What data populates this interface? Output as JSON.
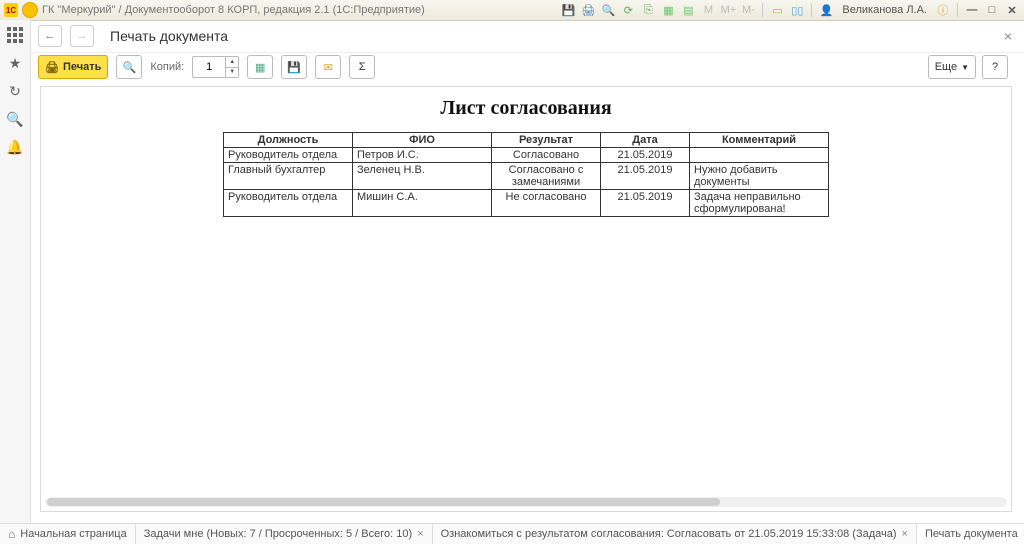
{
  "titlebar": {
    "logo_text": "1C",
    "app_title": "ГК \"Меркурий\" / Документооборот 8 КОРП, редакция 2.1  (1С:Предприятие)",
    "username": "Великанова Л.А."
  },
  "header": {
    "page_title": "Печать документа"
  },
  "toolbar": {
    "print_label": "Печать",
    "copies_label": "Копий:",
    "copies_value": "1",
    "more_label": "Еще",
    "help_label": "?"
  },
  "document": {
    "title": "Лист согласования",
    "columns": {
      "position": "Должность",
      "fio": "ФИО",
      "result": "Результат",
      "date": "Дата",
      "comment": "Комментарий"
    },
    "rows": [
      {
        "position": "Руководитель отдела",
        "fio": "Петров И.С.",
        "result": "Согласовано",
        "date": "21.05.2019",
        "comment": ""
      },
      {
        "position": "Главный бухгалтер",
        "fio": "Зеленец Н.В.",
        "result": "Согласовано с замечаниями",
        "date": "21.05.2019",
        "comment": "Нужно добавить документы"
      },
      {
        "position": "Руководитель отдела",
        "fio": "Мишин С.А.",
        "result": "Не согласовано",
        "date": "21.05.2019",
        "comment": "Задача неправильно сформулирована!"
      }
    ]
  },
  "tabs": {
    "home": "Начальная страница",
    "tasks": "Задачи мне (Новых: 7 / Просроченных: 5 / Всего: 10)",
    "review": "Ознакомиться с результатом согласования: Согласовать от 21.05.2019 15:33:08 (Задача)",
    "print": "Печать документа"
  }
}
